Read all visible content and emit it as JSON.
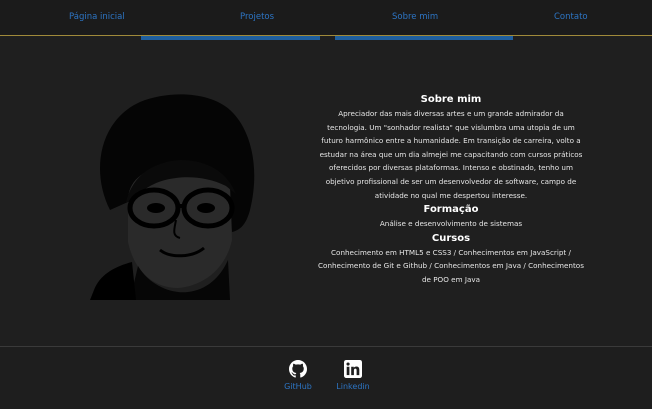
{
  "nav": {
    "items": [
      {
        "label": "Página inicial"
      },
      {
        "label": "Projetos"
      },
      {
        "label": "Sobre mim"
      },
      {
        "label": "Contato"
      }
    ]
  },
  "about": {
    "title": "Sobre mim",
    "text": "Apreciador das mais diversas artes e um grande admirador da tecnologia. Um \"sonhador realista\" que vislumbra uma utopia de um futuro harmônico entre a humanidade. Em transição de carreira, volto a estudar na área que um dia almejei me capacitando com cursos práticos oferecidos por diversas plataformas. Intenso e obstinado, tenho um objetivo profissional de ser um desenvolvedor de software, campo de atividade no qual me despertou interesse."
  },
  "education": {
    "title": "Formação",
    "text": "Análise e desenvolvimento de sistemas"
  },
  "courses": {
    "title": "Cursos",
    "text": "Conhecimento em HTML5 e CSS3 / Conhecimentos em JavaScript / Conhecimento de Git e Github / Conhecimentos em Java / Conhecimentos de POO em Java"
  },
  "footer": {
    "github_label": "GitHub",
    "linkedin_label": "Linkedin",
    "github_icon": "github-icon",
    "linkedin_icon": "linkedin-icon"
  },
  "colors": {
    "background": "#1f1f1f",
    "link": "#2d75c4",
    "nav_border": "#a08a3a",
    "tab_bar": "#1f5f9e"
  }
}
